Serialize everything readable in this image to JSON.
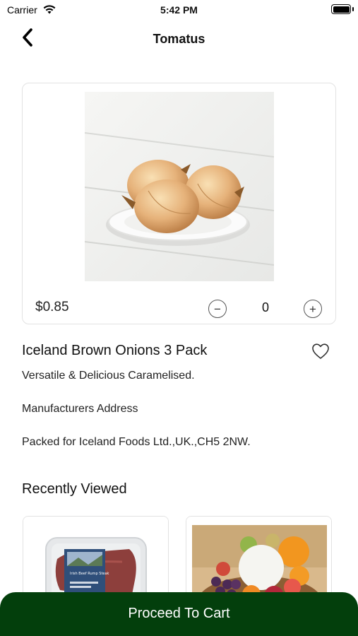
{
  "status_bar": {
    "carrier": "Carrier",
    "time": "5:42 PM",
    "icons": [
      "wifi-icon",
      "battery-icon"
    ]
  },
  "nav": {
    "title": "Tomatus",
    "back_icon": "chevron-left-icon"
  },
  "product": {
    "image_subject": "onions-on-plate",
    "price": "$0.85",
    "quantity": "0",
    "minus_symbol": "−",
    "plus_symbol": "+",
    "name": "Iceland Brown Onions 3 Pack",
    "favorite_icon": "heart-outline-icon",
    "description": "Versatile & Delicious Caramelised.",
    "manufacturer_heading": "Manufacturers Address",
    "manufacturer_address": "Packed for Iceland Foods Ltd.,UK.,CH5 2NW."
  },
  "recently_viewed": {
    "title": "Recently Viewed",
    "items": [
      {
        "image_subject": "packaged-beef-steak",
        "pack_text": "Irish Beef Rump Steak"
      },
      {
        "image_subject": "fruit-basket"
      }
    ]
  },
  "footer": {
    "proceed_label": "Proceed To Cart"
  },
  "colors": {
    "primary": "#033f0c",
    "card_border": "#e2e2e2",
    "text": "#111111"
  }
}
